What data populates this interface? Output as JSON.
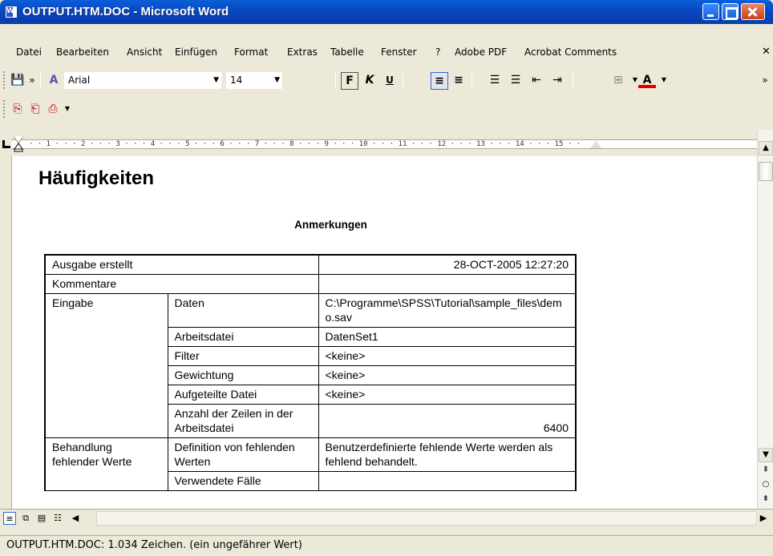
{
  "window": {
    "title": "OUTPUT.HTM.DOC - Microsoft Word"
  },
  "menu": [
    "Datei",
    "Bearbeiten",
    "Ansicht",
    "Einfügen",
    "Format",
    "Extras",
    "Tabelle",
    "Fenster",
    "?",
    "Adobe PDF",
    "Acrobat Comments"
  ],
  "toolbar": {
    "font_name": "Arial",
    "font_size": "14",
    "bold_label": "F",
    "italic_label": "K",
    "underline_label": "U",
    "chevron": "»"
  },
  "ruler": {
    "numbers": "· · 1 · · · 2 · · · 3 · · · 4 · · · 5 · · · 6 · · · 7 · · · 8 · · · 9 · · · 10 · · · 11 · · · 12 · · · 13 · · · 14 · · · 15 · ·"
  },
  "document": {
    "heading": "Häufigkeiten",
    "table_title": "Anmerkungen",
    "rows": {
      "r1": {
        "label": "Ausgabe erstellt",
        "value": "28-OCT-2005 12:27:20"
      },
      "r2": {
        "label": "Kommentare",
        "value": ""
      },
      "input": {
        "group": "Eingabe",
        "items": [
          {
            "label": "Daten",
            "value": "C:\\Programme\\SPSS\\Tutorial\\sample_files\\demo.sav"
          },
          {
            "label": "Arbeitsdatei",
            "value": "DatenSet1"
          },
          {
            "label": "Filter",
            "value": "<keine>"
          },
          {
            "label": "Gewichtung",
            "value": "<keine>"
          },
          {
            "label": "Aufgeteilte Datei",
            "value": "<keine>"
          },
          {
            "label": "Anzahl der Zeilen in der Arbeitsdatei",
            "value": "6400"
          }
        ]
      },
      "missing": {
        "group": "Behandlung fehlender Werte",
        "items": [
          {
            "label": "Definition von fehlenden Werten",
            "value": "Benutzerdefinierte fehlende Werte werden als fehlend behandelt."
          },
          {
            "label": "Verwendete Fälle",
            "value": ""
          }
        ]
      }
    }
  },
  "statusbar": {
    "text": "OUTPUT.HTM.DOC: 1.034 Zeichen. (ein ungefährer Wert)"
  }
}
